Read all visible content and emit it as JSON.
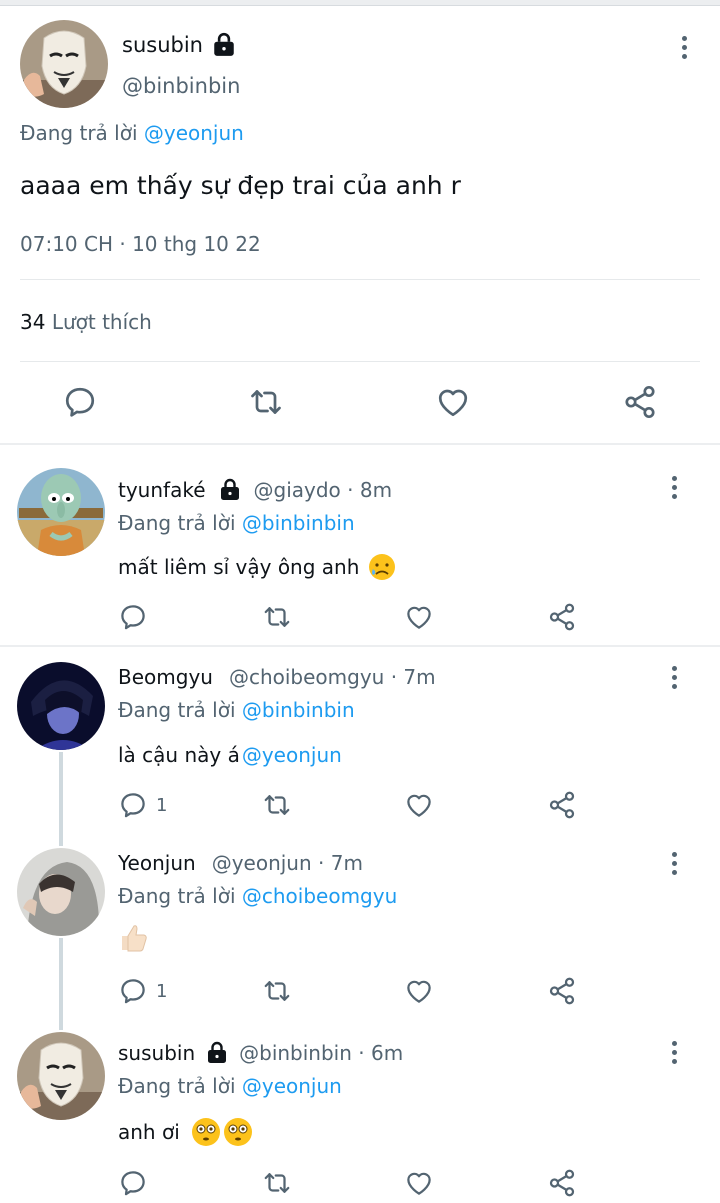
{
  "main_tweet": {
    "display_name": "susubin",
    "handle": "@binbinbin",
    "reply_prefix": "Đang trả lời",
    "reply_mention": "@yeonjun",
    "text": "aaaa em thấy sự đẹp trai của anh r",
    "timestamp": "07:10 CH · 10 thg 10 22",
    "likes_count": "34",
    "likes_label": "Lượt thích",
    "actions": [
      "reply-icon",
      "retweet-icon",
      "like-icon",
      "share-icon"
    ]
  },
  "replies": [
    {
      "display_name": "tyunfaké",
      "locked": true,
      "meta": "@giaydo · 8m",
      "reply_prefix": "Đang trả lời",
      "reply_mention": "@binbinbin",
      "text": "mất liêm sỉ vậy ông anh",
      "emoji": "sad-face-emoji",
      "reply_count": ""
    },
    {
      "display_name": "Beomgyu",
      "locked": false,
      "meta": "@choibeomgyu · 7m",
      "reply_prefix": "Đang trả lời",
      "reply_mention": "@binbinbin",
      "text": "là cậu này á",
      "text_mention": "@yeonjun",
      "reply_count": "1"
    },
    {
      "display_name": "Yeonjun",
      "locked": false,
      "meta": "@yeonjun · 7m",
      "reply_prefix": "Đang trả lời",
      "reply_mention": "@choibeomgyu",
      "text": "",
      "emoji": "thumbs-up-emoji",
      "reply_count": "1"
    },
    {
      "display_name": "susubin",
      "locked": true,
      "meta": "@binbinbin · 6m",
      "reply_prefix": "Đang trả lời",
      "reply_mention": "@yeonjun",
      "text": "anh ơi",
      "emoji": "flushed-face-emoji",
      "reply_count": ""
    }
  ],
  "colors": {
    "link": "#1d9bf0",
    "secondary_text": "#536471",
    "primary_text": "#0f1419",
    "divider": "#eceef0"
  }
}
